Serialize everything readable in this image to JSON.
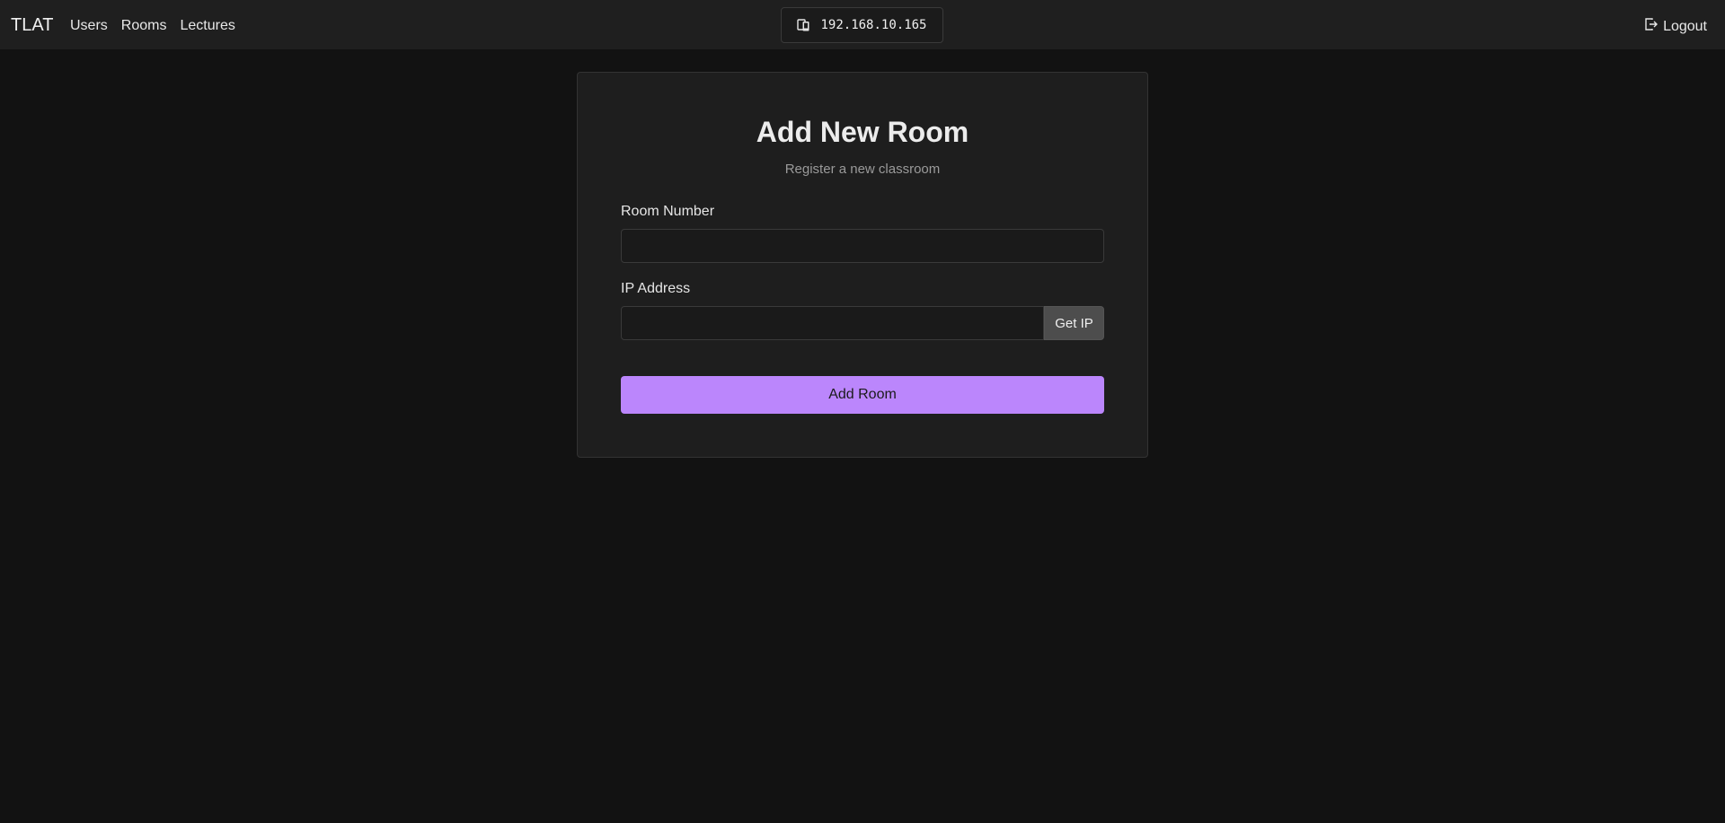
{
  "navbar": {
    "brand": "TLAT",
    "links": [
      {
        "label": "Users"
      },
      {
        "label": "Rooms"
      },
      {
        "label": "Lectures"
      }
    ],
    "ip_display": {
      "icon": "device-icon",
      "value": "192.168.10.165"
    },
    "logout": {
      "icon": "logout-icon",
      "label": "Logout"
    }
  },
  "form": {
    "title": "Add New Room",
    "subtitle": "Register a new classroom",
    "room_number": {
      "label": "Room Number",
      "value": "",
      "placeholder": ""
    },
    "ip_address": {
      "label": "IP Address",
      "value": "",
      "placeholder": "",
      "get_ip_label": "Get IP"
    },
    "submit_label": "Add Room"
  },
  "colors": {
    "background": "#121212",
    "navbar": "#1f1f1f",
    "card": "#1e1e1e",
    "accent": "#bb86fc",
    "get_ip_button": "#4d4d4d"
  }
}
